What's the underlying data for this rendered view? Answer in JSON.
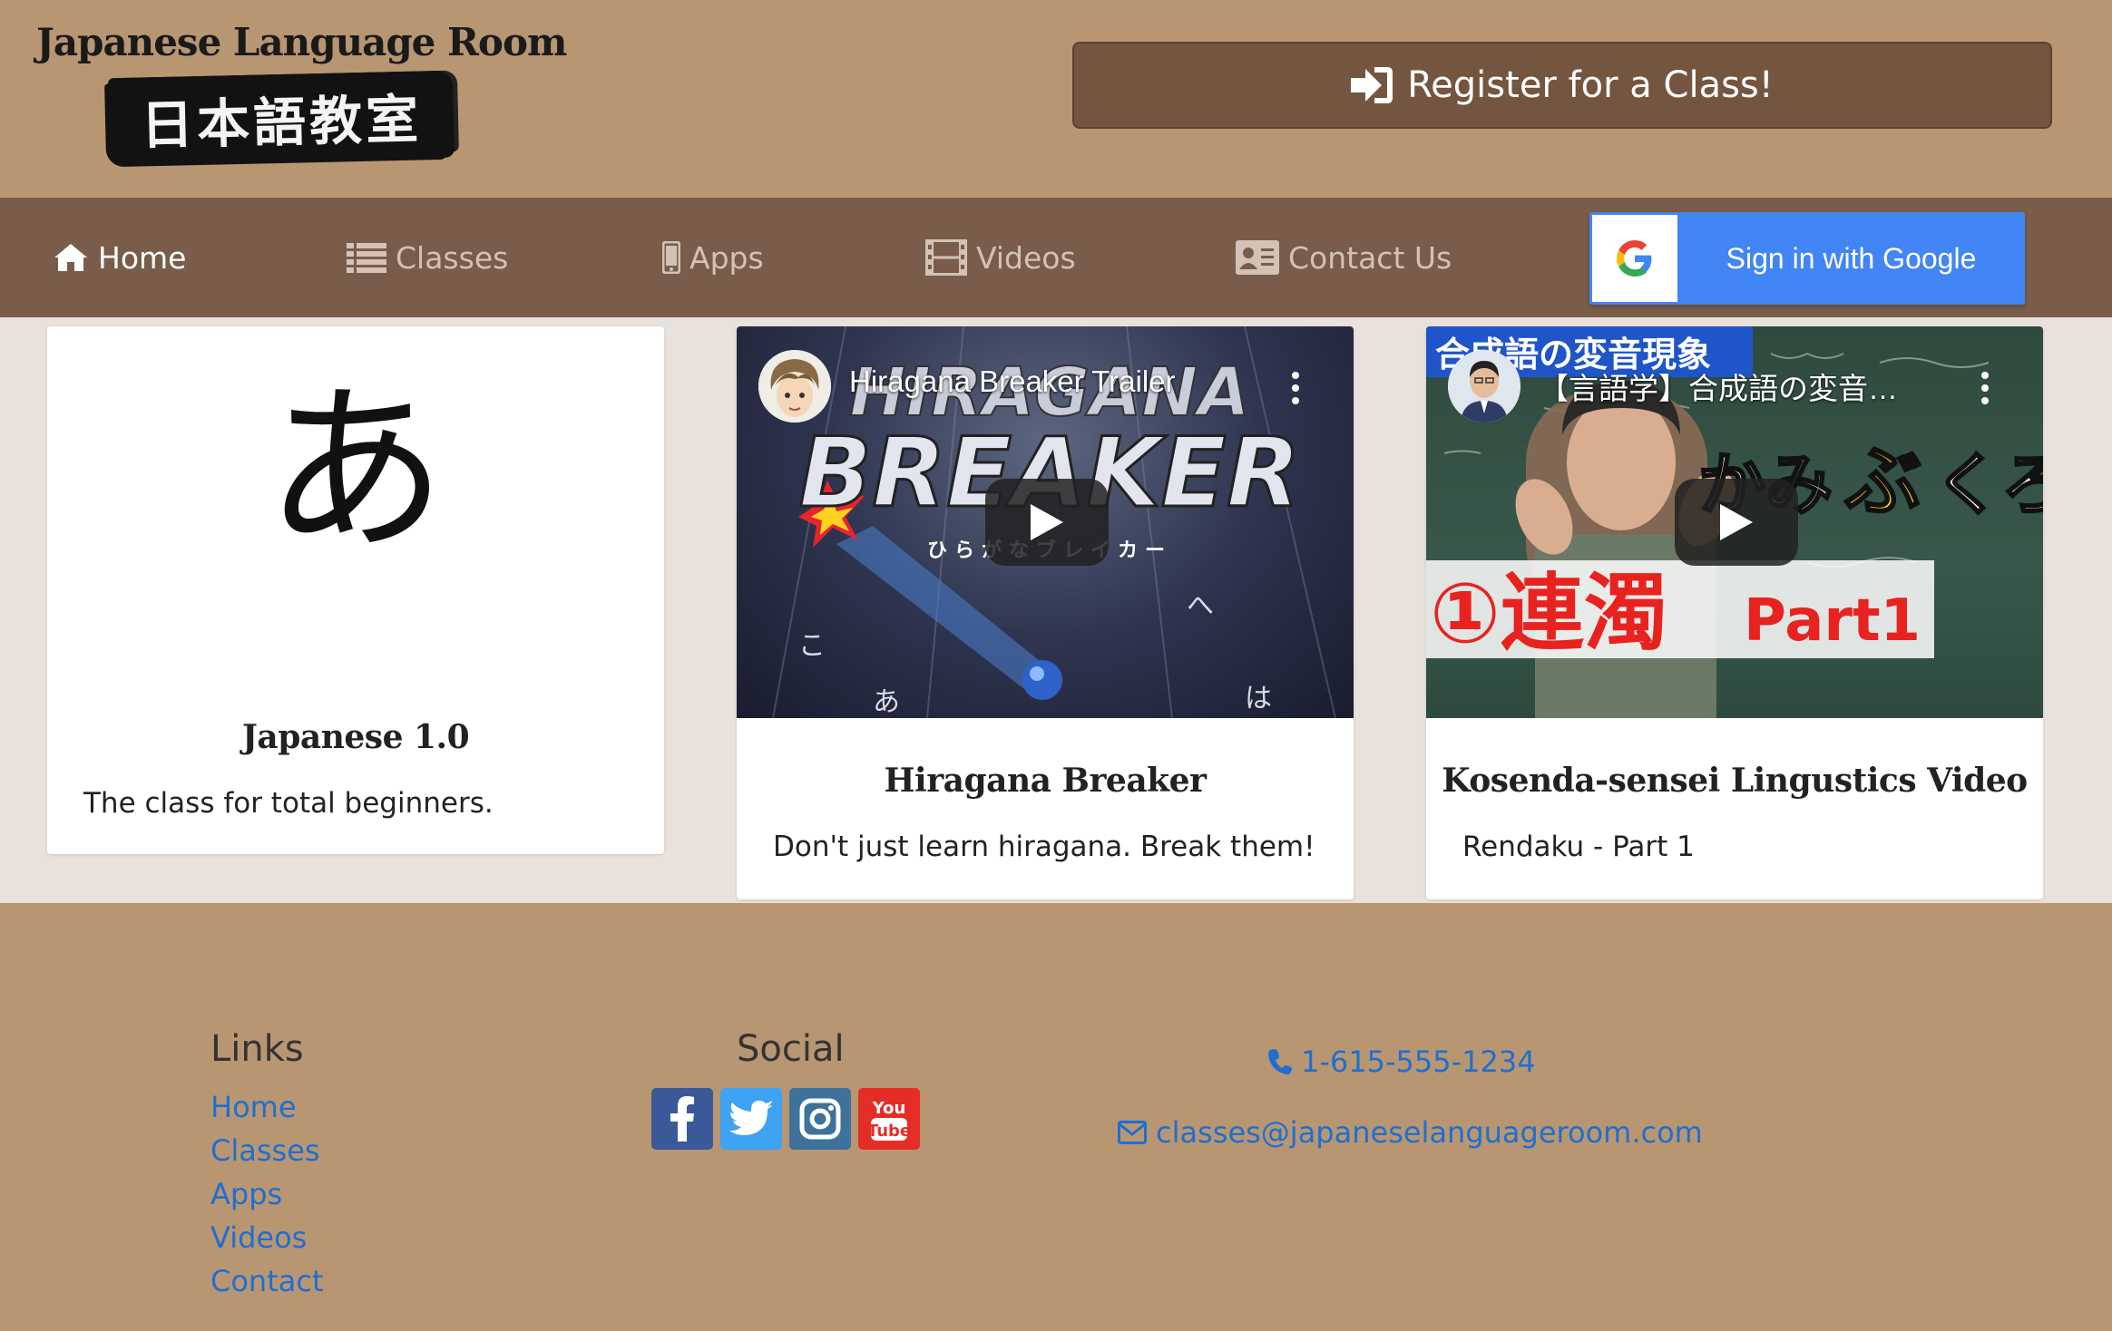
{
  "header": {
    "logo_title": "Japanese Language Room",
    "logo_kanji": "日本語教室",
    "register_label": "Register for a Class!"
  },
  "nav": {
    "items": [
      {
        "label": "Home",
        "icon": "home-icon",
        "active": true
      },
      {
        "label": "Classes",
        "icon": "list-icon",
        "active": false
      },
      {
        "label": "Apps",
        "icon": "mobile-icon",
        "active": false
      },
      {
        "label": "Videos",
        "icon": "film-icon",
        "active": false
      },
      {
        "label": "Contact Us",
        "icon": "contact-card-icon",
        "active": false
      }
    ],
    "google_label": "Sign in with Google"
  },
  "cards": [
    {
      "kana": "あ",
      "title": "Japanese 1.0",
      "text": "The class for total beginners."
    },
    {
      "title": "Hiragana Breaker",
      "text": "Don't just learn hiragana. Break them!",
      "video_title": "Hiragana Breaker Trailer",
      "thumb_line1": "HIRAGANA",
      "thumb_line2": "BREAKER",
      "thumb_sub": "ひらがなブレイカー",
      "thumb_kana": [
        "こ",
        "あ",
        "へ",
        "は"
      ]
    },
    {
      "title": "Kosenda-sensei Lingustics Video",
      "text": "Rendaku - Part 1",
      "video_title": "【言語学】合成語の変音…",
      "thumb_banner": "合成語の変音現象",
      "thumb_big": "①連濁",
      "thumb_part": "Part1"
    }
  ],
  "footer": {
    "links_heading": "Links",
    "links": [
      "Home",
      "Classes",
      "Apps",
      "Videos",
      "Contact"
    ],
    "social_heading": "Social",
    "social": [
      {
        "name": "facebook",
        "color": "#3b5998"
      },
      {
        "name": "twitter",
        "color": "#1da1f2"
      },
      {
        "name": "instagram",
        "color": "#3f729b"
      },
      {
        "name": "youtube",
        "color": "#e52d27"
      }
    ],
    "phone": "1-615-555-1234",
    "email": "classes@japaneselanguageroom.com"
  },
  "colors": {
    "background": "#b89672",
    "nav": "#7a5c4a",
    "register_button": "#745540",
    "content_bg": "#e8e1dc",
    "link": "#1e6fd0",
    "google_blue": "#4285f4"
  }
}
